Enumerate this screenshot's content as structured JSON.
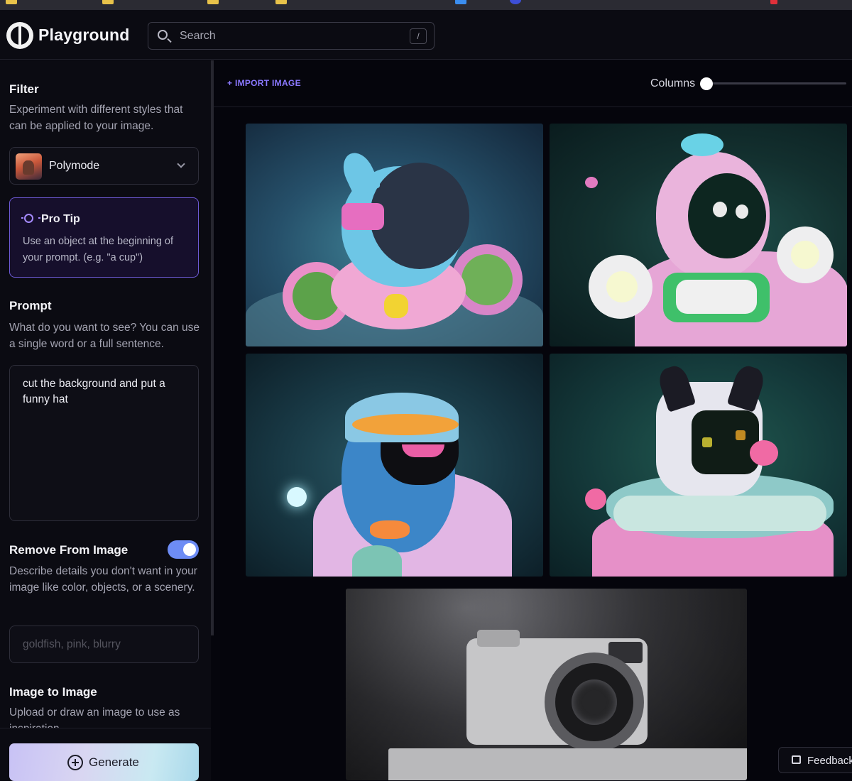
{
  "app": {
    "name": "Playground"
  },
  "search": {
    "placeholder": "Search",
    "shortcut": "/"
  },
  "sidebar": {
    "filter": {
      "title": "Filter",
      "description": "Experiment with different styles that can be applied to your image.",
      "selected": "Polymode"
    },
    "pro_tip": {
      "title": "Pro Tip",
      "text": "Use an object at the beginning of your prompt. (e.g. \"a cup\")"
    },
    "prompt": {
      "title": "Prompt",
      "description": "What do you want to see? You can use a single word or a full sentence.",
      "value": "cut the background and put a funny hat"
    },
    "remove_from_image": {
      "title": "Remove From Image",
      "enabled": true,
      "description": "Describe details you don't want in your image like color, objects, or a scenery.",
      "placeholder": "goldfish, pink, blurry"
    },
    "image_to_image": {
      "title": "Image to Image",
      "description": "Upload or draw an image to use as inspiration"
    },
    "generate_label": "Generate"
  },
  "toolbar": {
    "import_label": "+ IMPORT IMAGE",
    "columns_label": "Columns",
    "columns_value": 0
  },
  "feedback_label": "Feedback",
  "colors": {
    "accent": "#8a78ff",
    "toggle": "#6d8cf5",
    "protip_border": "#6d5ad6",
    "background": "#05050c"
  }
}
